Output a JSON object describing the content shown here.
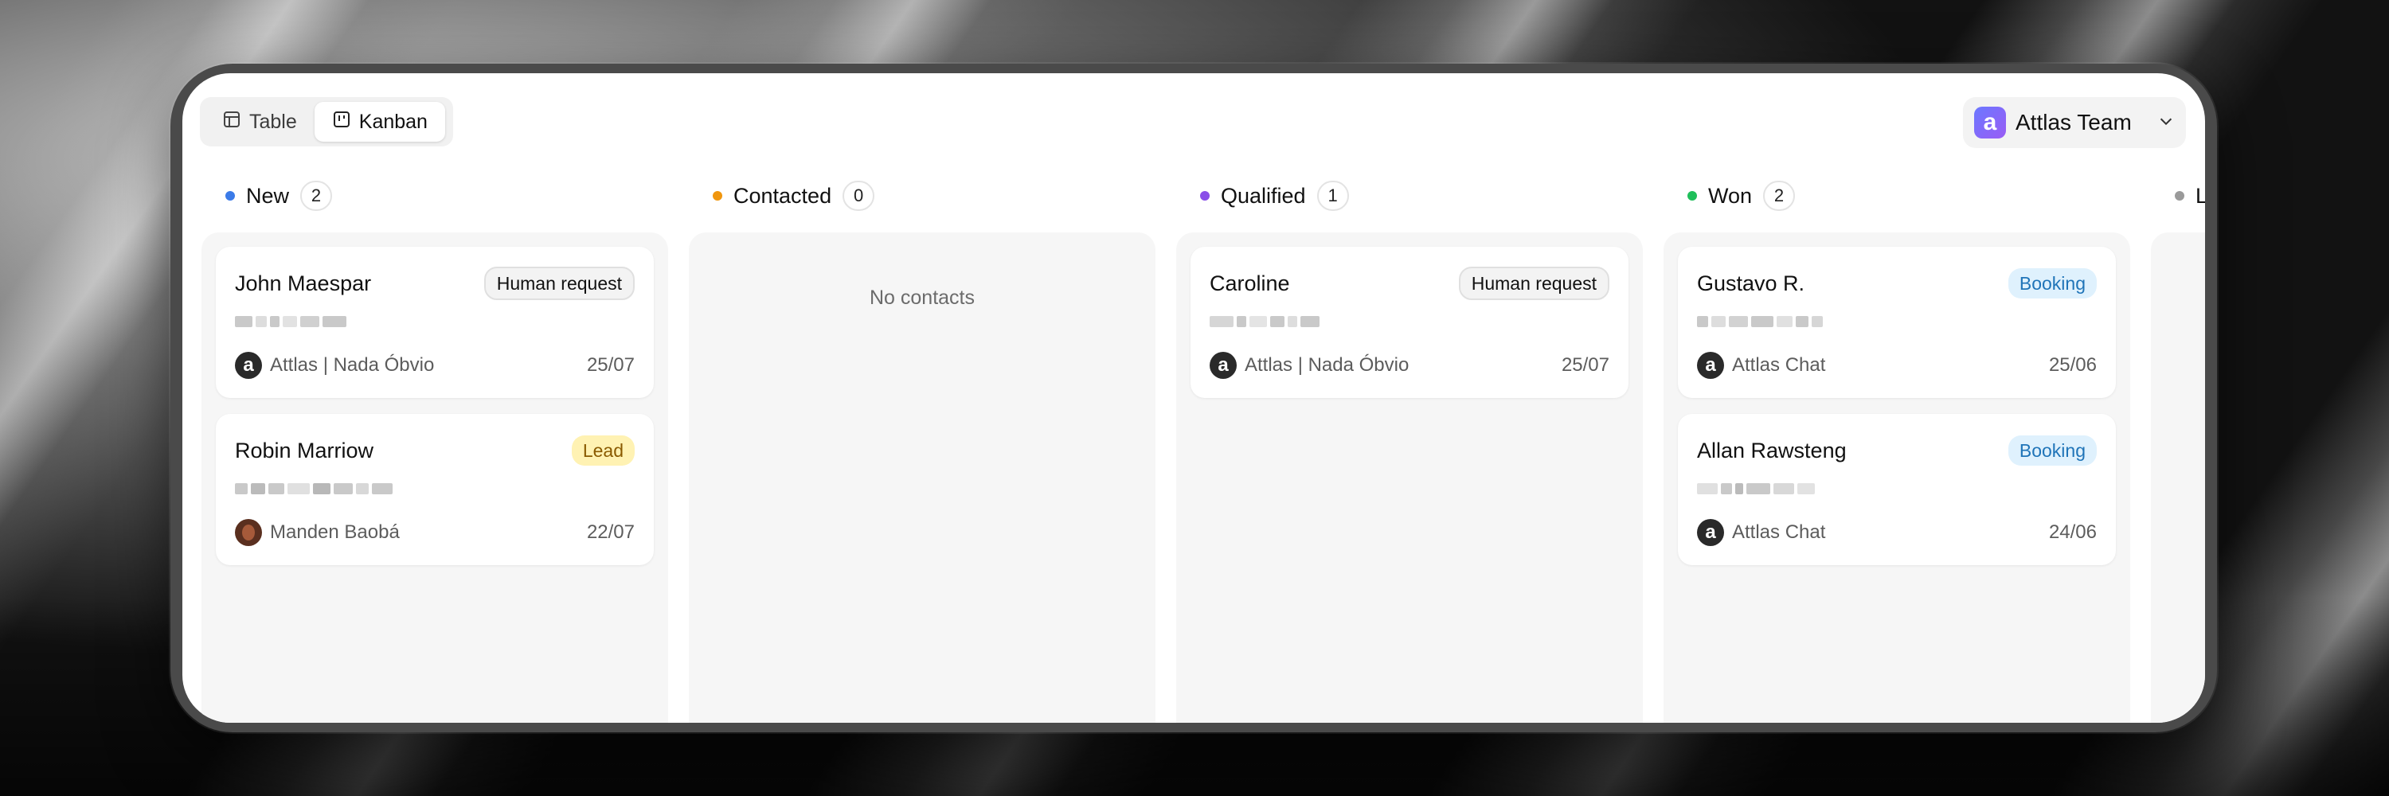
{
  "view_toggle": {
    "table_label": "Table",
    "kanban_label": "Kanban",
    "active": "Kanban"
  },
  "team": {
    "logo_letter": "a",
    "name": "Attlas Team"
  },
  "columns": [
    {
      "title": "New",
      "count": "2",
      "color": "#3b7be8",
      "cards": [
        {
          "name": "John Maespar",
          "tag": "Human request",
          "tag_type": "human",
          "source": "Attlas | Nada Óbvio",
          "source_icon": "attlas",
          "date": "25/07"
        },
        {
          "name": "Robin Marriow",
          "tag": "Lead",
          "tag_type": "lead",
          "source": "Manden Baobá",
          "source_icon": "avatar",
          "date": "22/07"
        }
      ]
    },
    {
      "title": "Contacted",
      "count": "0",
      "color": "#f0960e",
      "empty_text": "No contacts",
      "cards": []
    },
    {
      "title": "Qualified",
      "count": "1",
      "color": "#8a4fe8",
      "cards": [
        {
          "name": "Caroline",
          "tag": "Human request",
          "tag_type": "human",
          "source": "Attlas | Nada Óbvio",
          "source_icon": "attlas",
          "date": "25/07"
        }
      ]
    },
    {
      "title": "Won",
      "count": "2",
      "color": "#1fbf5a",
      "cards": [
        {
          "name": "Gustavo R.",
          "tag": "Booking",
          "tag_type": "booking",
          "source": "Attlas Chat",
          "source_icon": "attlas",
          "date": "25/06"
        },
        {
          "name": "Allan Rawsteng",
          "tag": "Booking",
          "tag_type": "booking",
          "source": "Attlas Chat",
          "source_icon": "attlas",
          "date": "24/06"
        }
      ]
    },
    {
      "title": "Lost",
      "count": "",
      "color": "#9a9a9a",
      "cards": []
    }
  ]
}
